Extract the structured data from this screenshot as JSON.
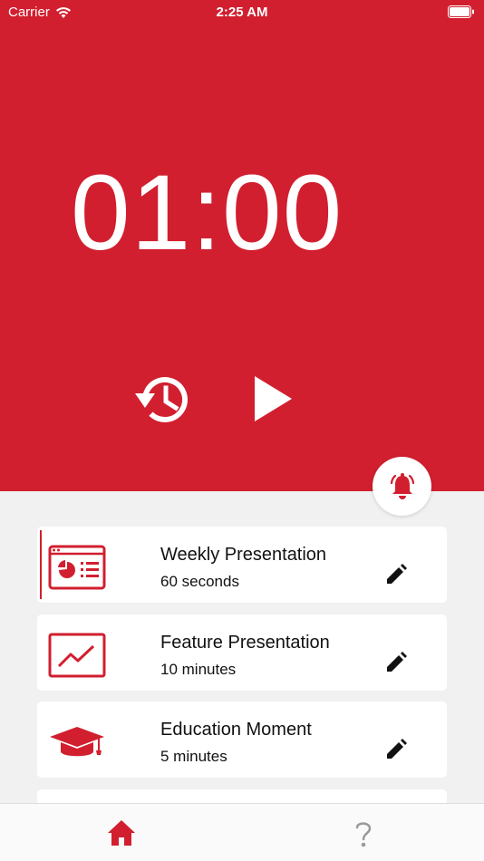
{
  "status_bar": {
    "carrier": "Carrier",
    "time": "2:25 AM"
  },
  "timer": {
    "display": "01:00"
  },
  "controls": {
    "reset_icon": "history-reset-icon",
    "play_icon": "play-icon",
    "alarm_icon": "alarm-bell-icon"
  },
  "presets": [
    {
      "title": "Weekly Presentation",
      "duration": "60 seconds",
      "icon": "presentation-board-icon",
      "selected": true
    },
    {
      "title": "Feature Presentation",
      "duration": "10 minutes",
      "icon": "line-chart-board-icon",
      "selected": false
    },
    {
      "title": "Education Moment",
      "duration": "5 minutes",
      "icon": "graduation-cap-icon",
      "selected": false
    }
  ],
  "tabs": [
    {
      "name": "home",
      "icon": "home-icon",
      "active": true
    },
    {
      "name": "help",
      "icon": "question-icon",
      "active": false
    }
  ],
  "colors": {
    "accent": "#d11f2f",
    "background": "#f1f1f1",
    "card": "#ffffff",
    "tab_inactive": "#9a9a9a"
  }
}
